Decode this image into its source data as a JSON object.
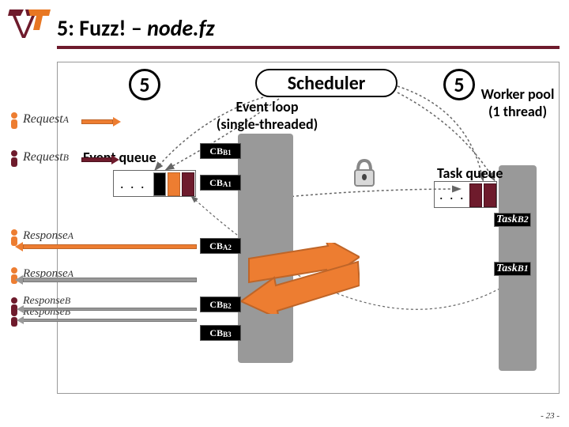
{
  "title_prefix": "5: Fuzz! – ",
  "title_italic": "node.fz",
  "circle5": "5",
  "scheduler": "Scheduler",
  "event_loop_l1": "Event loop",
  "event_loop_l2": "(single-threaded)",
  "worker_pool_l1": "Worker pool",
  "worker_pool_l2": "(1 thread)",
  "event_queue": "Event queue",
  "task_queue": "Task queue",
  "requestA": "Request",
  "requestA_sub": "A",
  "requestB": "Request",
  "requestB_sub": "B",
  "responseA": "Response",
  "responseA_sub": "A",
  "responseB": "Response",
  "responseB_sub": "B",
  "cbb1_p": "CB",
  "cbb1_s": "B1",
  "cba1_p": "CB",
  "cba1_s": "A1",
  "cba2_p": "CB",
  "cba2_s": "A2",
  "cbb2_p": "CB",
  "cbb2_s": "B2",
  "cbb3_p": "CB",
  "cbb3_s": "B3",
  "taskB2_p": "Task",
  "taskB2_s": "B2",
  "taskB1_p": "Task",
  "taskB1_s": "B1",
  "dots": ". . .",
  "page": "- 23 -"
}
